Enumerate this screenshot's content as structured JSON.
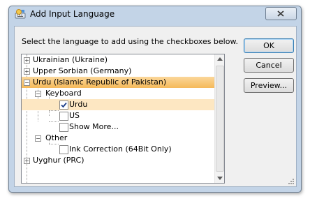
{
  "window": {
    "title": "Add Input Language"
  },
  "instruction": "Select the language to add using the checkboxes below.",
  "tree": {
    "items": [
      {
        "label": "Ukrainian (Ukraine)"
      },
      {
        "label": "Upper Sorbian (Germany)"
      },
      {
        "label": "Urdu (Islamic Republic of Pakistan)",
        "selected": true
      },
      {
        "label": "Keyboard"
      },
      {
        "label": "Urdu",
        "checked": true
      },
      {
        "label": "US",
        "checked": false
      },
      {
        "label": "Show More...",
        "checked": false
      },
      {
        "label": "Other"
      },
      {
        "label": "Ink Correction (64Bit Only)",
        "checked": false
      },
      {
        "label": "Uyghur (PRC)"
      }
    ]
  },
  "buttons": {
    "ok": "OK",
    "cancel": "Cancel",
    "preview": "Preview..."
  },
  "colors": {
    "selection": "#f5b95a",
    "frame": "#c3d4e7"
  }
}
